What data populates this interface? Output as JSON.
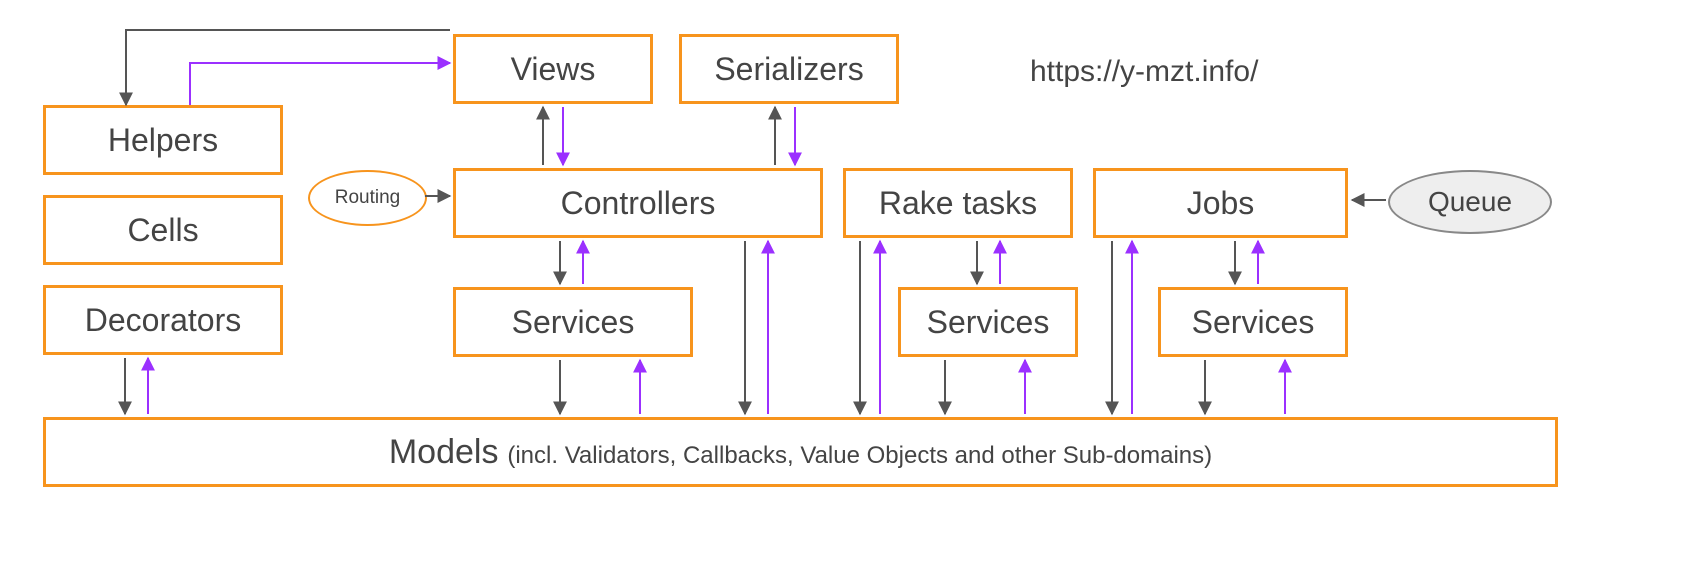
{
  "url": "https://y-mzt.info/",
  "boxes": {
    "helpers": "Helpers",
    "cells": "Cells",
    "decorators": "Decorators",
    "views": "Views",
    "serializers": "Serializers",
    "controllers": "Controllers",
    "raketasks": "Rake tasks",
    "jobs": "Jobs",
    "services1": "Services",
    "services2": "Services",
    "services3": "Services",
    "models_main": "Models",
    "models_sub": "(incl. Validators, Callbacks, Value Objects and other Sub-domains)"
  },
  "ellipses": {
    "routing": "Routing",
    "queue": "Queue"
  },
  "colors": {
    "box_border": "#f7941d",
    "arrow_dark": "#555555",
    "arrow_purple": "#9b30ff",
    "queue_fill": "#eeeeee"
  }
}
